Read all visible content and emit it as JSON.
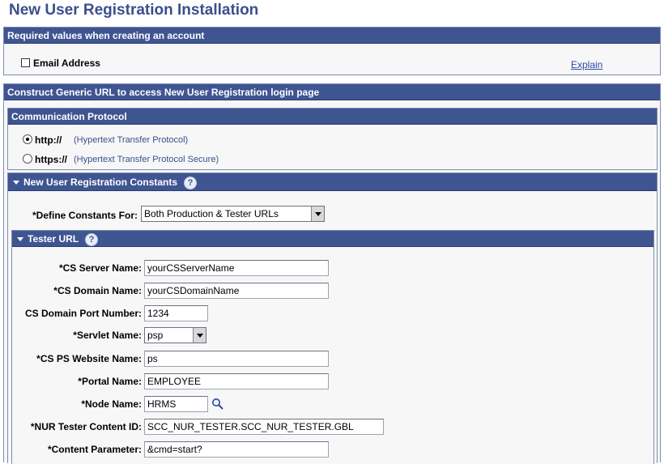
{
  "page": {
    "title": "New User Registration Installation"
  },
  "required_section": {
    "header": "Required values when creating an account",
    "email_label": "Email Address",
    "explain_link": "Explain"
  },
  "url_section": {
    "header": "Construct Generic URL to access New User Registration login page",
    "protocol": {
      "header": "Communication Protocol",
      "options": [
        {
          "label": "http://",
          "desc": "(Hypertext Transfer Protocol)",
          "selected": true
        },
        {
          "label": "https://",
          "desc": "(Hypertext Transfer Protocol Secure)",
          "selected": false
        }
      ]
    },
    "constants": {
      "header": "New User Registration Constants",
      "help": "?",
      "define_label": "*Define Constants For:",
      "define_value": "Both Production & Tester URLs",
      "tester": {
        "header": "Tester URL",
        "help": "?",
        "fields": {
          "cs_server_label": "*CS Server Name:",
          "cs_server_value": "yourCSServerName",
          "cs_domain_label": "*CS Domain Name:",
          "cs_domain_value": "yourCSDomainName",
          "port_label": "CS Domain Port Number:",
          "port_value": "1234",
          "servlet_label": "*Servlet Name:",
          "servlet_value": "psp",
          "website_label": "*CS PS Website Name:",
          "website_value": "ps",
          "portal_label": "*Portal Name:",
          "portal_value": "EMPLOYEE",
          "node_label": "*Node Name:",
          "node_value": "HRMS",
          "content_id_label": "*NUR Tester Content ID:",
          "content_id_value": "SCC_NUR_TESTER.SCC_NUR_TESTER.GBL",
          "content_param_label": "*Content Parameter:",
          "content_param_value": "&cmd=start?"
        }
      }
    }
  },
  "colors": {
    "header_bg": "#3f5592",
    "title": "#3a4f8c",
    "link": "#2a4aa0"
  },
  "icons": {
    "lookup": "magnifier-icon",
    "collapse": "triangle-down-icon",
    "help": "help-icon"
  }
}
